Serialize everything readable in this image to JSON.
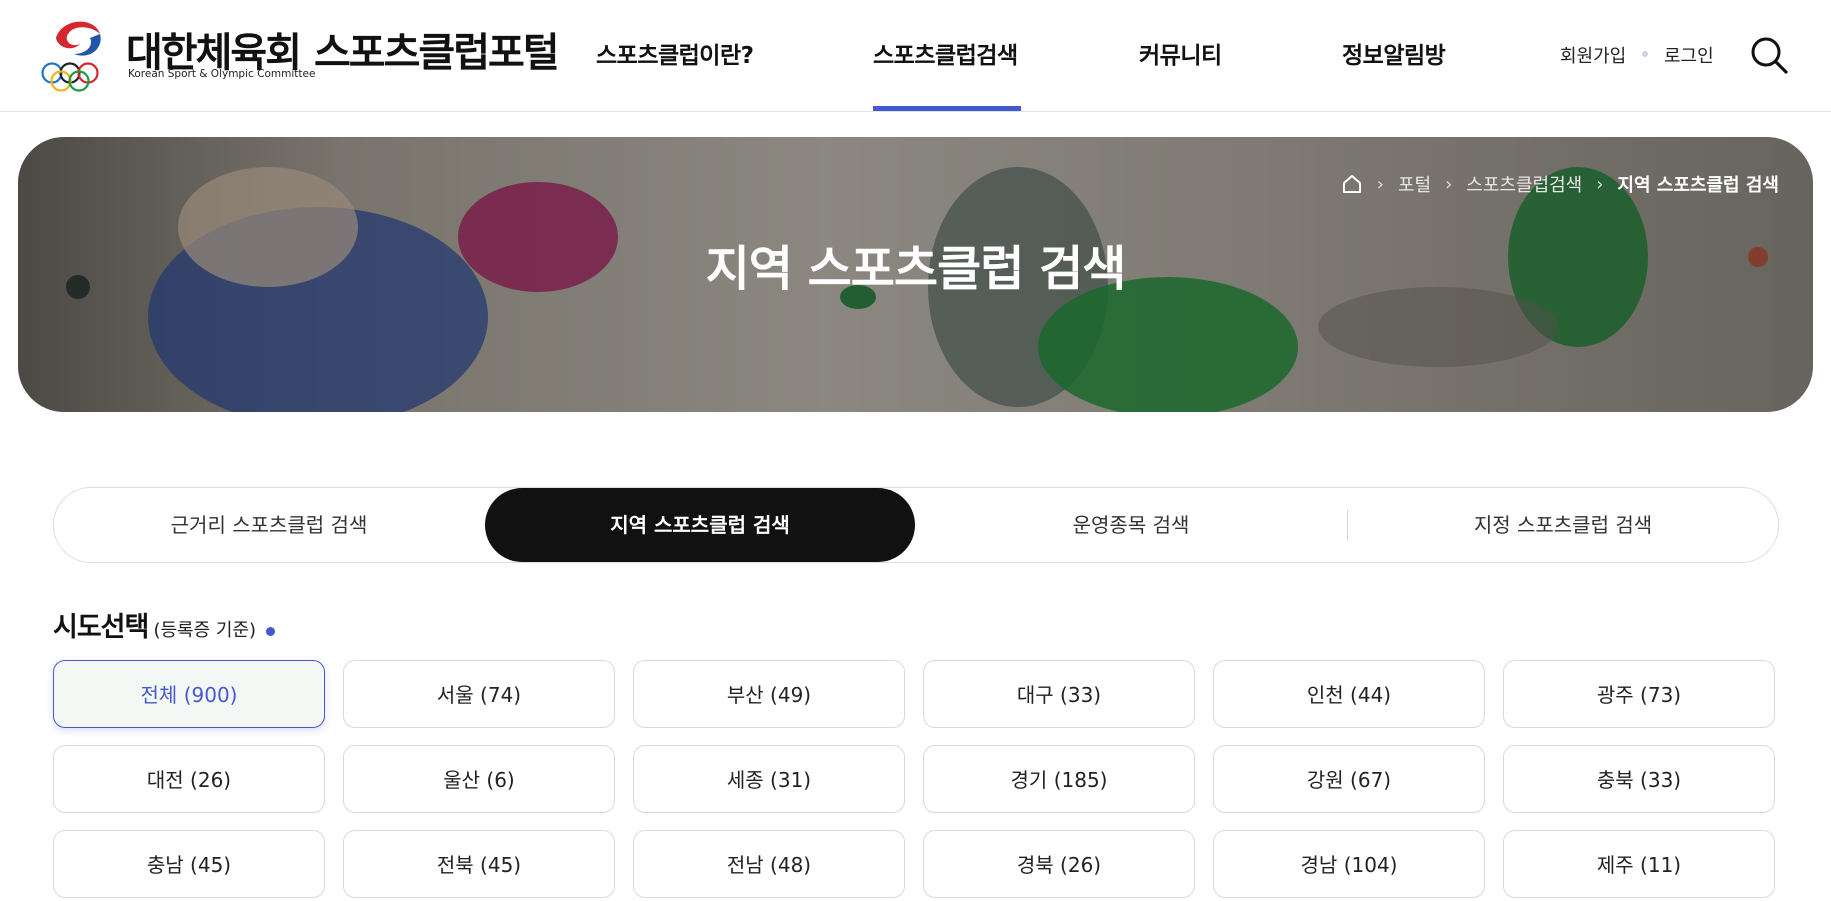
{
  "header": {
    "logo_org_kor": "대한체육회",
    "logo_org_eng": "Korean Sport & Olympic Committee",
    "logo_title": "스포츠클럽포털",
    "nav": [
      {
        "label": "스포츠클럽이란?"
      },
      {
        "label": "스포츠클럽검색",
        "active": true
      },
      {
        "label": "커뮤니티"
      },
      {
        "label": "정보알림방"
      }
    ],
    "join_label": "회원가입",
    "login_label": "로그인",
    "search_icon": "search-icon"
  },
  "banner": {
    "title": "지역 스포츠클럽 검색",
    "breadcrumb": {
      "home_icon": "home-icon",
      "items": [
        "포털",
        "스포츠클럽검색",
        "지역 스포츠클럽 검색"
      ]
    }
  },
  "tabs": [
    {
      "label": "근거리 스포츠클럽 검색"
    },
    {
      "label": "지역 스포츠클럽 검색",
      "active": true
    },
    {
      "label": "운영종목 검색"
    },
    {
      "label": "지정 스포츠클럽 검색"
    }
  ],
  "region_section": {
    "title": "시도선택",
    "subtitle": "(등록증 기준)",
    "regions": [
      {
        "label": "전체 (900)",
        "active": true
      },
      {
        "label": "서울 (74)"
      },
      {
        "label": "부산 (49)"
      },
      {
        "label": "대구 (33)"
      },
      {
        "label": "인천 (44)"
      },
      {
        "label": "광주 (73)"
      },
      {
        "label": "대전 (26)"
      },
      {
        "label": "울산 (6)"
      },
      {
        "label": "세종 (31)"
      },
      {
        "label": "경기 (185)"
      },
      {
        "label": "강원 (67)"
      },
      {
        "label": "충북 (33)"
      },
      {
        "label": "충남 (45)"
      },
      {
        "label": "전북 (45)"
      },
      {
        "label": "전남 (48)"
      },
      {
        "label": "경북 (26)"
      },
      {
        "label": "경남 (104)"
      },
      {
        "label": "제주 (11)"
      }
    ]
  },
  "colors": {
    "accent": "#4657d2",
    "active_tab_bg": "#111111",
    "active_chip_bg": "#f4f8f4"
  }
}
